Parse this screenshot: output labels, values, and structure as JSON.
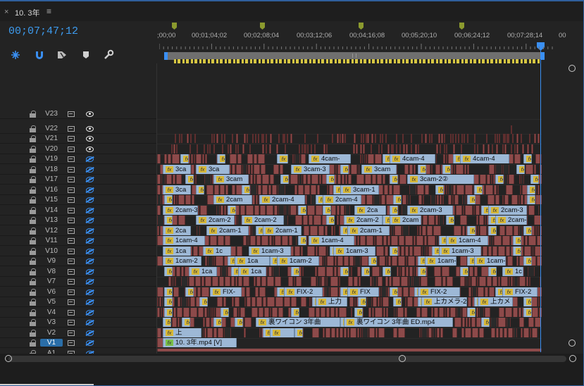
{
  "panel": {
    "close": "×",
    "title": "10. 3年",
    "menu": "≡"
  },
  "timecode": "00;07;47;12",
  "tools": {
    "snap": "snap-icon",
    "linked": "linked-selection-icon",
    "markers_toggle": "timeline-display-icon",
    "add_marker": "marker-icon",
    "settings": "wrench-icon"
  },
  "ruler": {
    "labels": [
      ";00;00",
      "00;01;04;02",
      "00;02;08;04",
      "00;03;12;06",
      "00;04;16;08",
      "00;05;20;10",
      "00;06;24;12",
      "00;07;28;14",
      "00"
    ]
  },
  "tracks": [
    {
      "name": "V23",
      "eye": true
    },
    {
      "name": "V22",
      "eye": true
    },
    {
      "name": "V21",
      "eye": true
    },
    {
      "name": "V20",
      "eye": true
    },
    {
      "name": "V19",
      "eye": false
    },
    {
      "name": "V18",
      "eye": false
    },
    {
      "name": "V17",
      "eye": false
    },
    {
      "name": "V16",
      "eye": false
    },
    {
      "name": "V15",
      "eye": false
    },
    {
      "name": "V14",
      "eye": false
    },
    {
      "name": "V13",
      "eye": false
    },
    {
      "name": "V12",
      "eye": false
    },
    {
      "name": "V11",
      "eye": false
    },
    {
      "name": "V10",
      "eye": false
    },
    {
      "name": "V9",
      "eye": false
    },
    {
      "name": "V8",
      "eye": false
    },
    {
      "name": "V7",
      "eye": false
    },
    {
      "name": "V6",
      "eye": false
    },
    {
      "name": "V5",
      "eye": false
    },
    {
      "name": "V4",
      "eye": false
    },
    {
      "name": "V3",
      "eye": false
    },
    {
      "name": "V2",
      "eye": false
    },
    {
      "name": "V1",
      "eye": false,
      "selected": true
    },
    {
      "name": "A1",
      "eye": false
    }
  ],
  "fx_label": "fx",
  "clips": {
    "V19": [
      "4cam-",
      "4cam-4",
      "4cam-4"
    ],
    "V18": [
      "3ca",
      "3ca",
      "3cam-3",
      "3cam"
    ],
    "V17": [
      "3cam",
      "3cam-2②"
    ],
    "V16": [
      "3ca",
      "3cam-1"
    ],
    "V15": [
      "2cam",
      "2cam-4",
      "2cam-4"
    ],
    "V14": [
      "2cam-3",
      "2ca",
      "2cam-3",
      "2cam-3"
    ],
    "V13": [
      "2cam-2",
      "2cam-2",
      "2cam-2",
      "2cam",
      "2cam-"
    ],
    "V12": [
      "2ca",
      "2cam-1",
      "2cam-1",
      "2cam-1"
    ],
    "V11": [
      "1cam-4",
      "1cam-4",
      "1cam-4"
    ],
    "V10": [
      "1ca",
      "1c",
      "1cam-3",
      "1cam-3",
      "1cam-3"
    ],
    "V9": [
      "1cam-2",
      "1ca",
      "1cam-2",
      "1cam-2",
      "1cam-2"
    ],
    "V8": [
      "1ca",
      "1ca",
      "1c"
    ],
    "V7": [],
    "V6": [
      "FIX-",
      "FIX-2",
      "FIX",
      "FIX-2",
      "FIX-2"
    ],
    "V5": [
      "上力",
      "上カメラ-2",
      "上カメ"
    ],
    "V4": [],
    "V3": [
      "裏ワイコン 3年曲",
      "裏ワイコン 3年曲 ED.mp4"
    ],
    "V2": [
      "上"
    ],
    "V1": [
      "10. 3年.mp4 [V]"
    ]
  }
}
